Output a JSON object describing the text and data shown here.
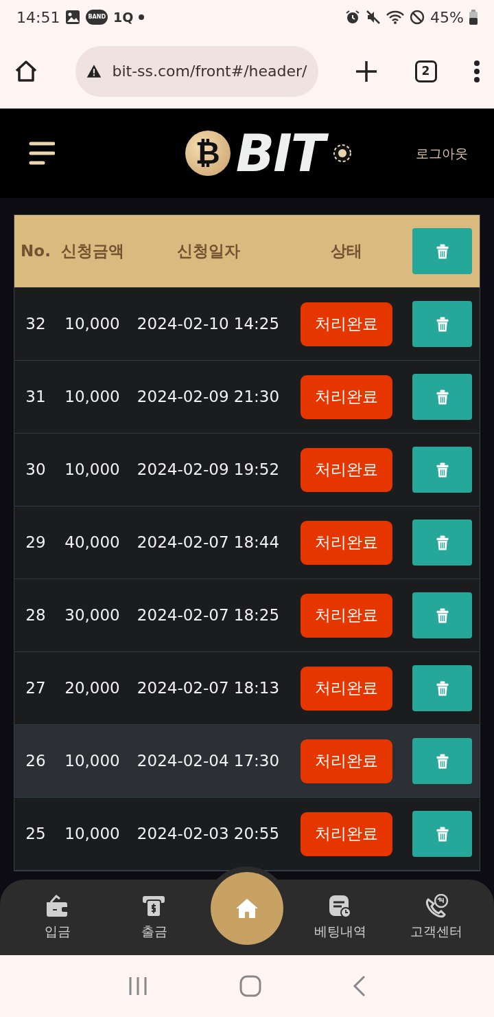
{
  "status_bar": {
    "time": "14:51",
    "notifications": [
      "BAND",
      "1Q"
    ],
    "battery": "45%"
  },
  "browser": {
    "url": "bit-ss.com/front#/header/",
    "tab_count": "2"
  },
  "header": {
    "logo_symbol": "₿",
    "logo_text": "BIT",
    "logout": "로그아웃"
  },
  "table": {
    "columns": [
      "No.",
      "신청금액",
      "신청일자",
      "상태"
    ],
    "rows": [
      {
        "no": "32",
        "amount": "10,000",
        "date": "2024-02-10 14:25",
        "status": "처리완료",
        "highlighted": false
      },
      {
        "no": "31",
        "amount": "10,000",
        "date": "2024-02-09 21:30",
        "status": "처리완료",
        "highlighted": false
      },
      {
        "no": "30",
        "amount": "10,000",
        "date": "2024-02-09 19:52",
        "status": "처리완료",
        "highlighted": false
      },
      {
        "no": "29",
        "amount": "40,000",
        "date": "2024-02-07 18:44",
        "status": "처리완료",
        "highlighted": false
      },
      {
        "no": "28",
        "amount": "30,000",
        "date": "2024-02-07 18:25",
        "status": "처리완료",
        "highlighted": false
      },
      {
        "no": "27",
        "amount": "20,000",
        "date": "2024-02-07 18:13",
        "status": "처리완료",
        "highlighted": false
      },
      {
        "no": "26",
        "amount": "10,000",
        "date": "2024-02-04 17:30",
        "status": "처리완료",
        "highlighted": true
      },
      {
        "no": "25",
        "amount": "10,000",
        "date": "2024-02-03 20:55",
        "status": "처리완료",
        "highlighted": false
      }
    ]
  },
  "bottom_nav": [
    {
      "label": "입금",
      "kind": "wallet"
    },
    {
      "label": "출금",
      "kind": "atm"
    },
    {
      "kind": "home"
    },
    {
      "label": "베팅내역",
      "kind": "history"
    },
    {
      "label": "고객센터",
      "kind": "support"
    }
  ]
}
